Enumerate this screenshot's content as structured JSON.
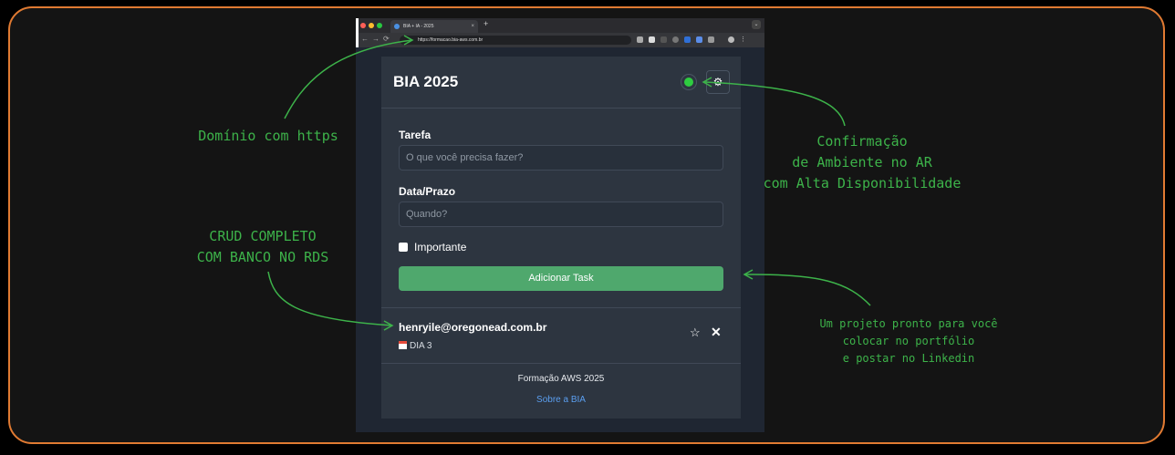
{
  "browser": {
    "tab_title": "BIA + IA - 2025",
    "tab_close": "×",
    "new_tab": "+",
    "tab_menu": "⌄",
    "url": "https://formacao.bia-aws.com.br",
    "nav_back": "←",
    "nav_forward": "→",
    "nav_reload": "⟳"
  },
  "app": {
    "title": "BIA 2025",
    "settings_icon": "⚙",
    "form": {
      "task_label": "Tarefa",
      "task_placeholder": "O que você precisa fazer?",
      "date_label": "Data/Prazo",
      "date_placeholder": "Quando?",
      "important_label": "Importante",
      "add_button": "Adicionar Task"
    },
    "tasks": [
      {
        "title": "henryile@oregonead.com.br",
        "date": "DIA 3",
        "star": "☆",
        "delete": "✕"
      }
    ],
    "footer": {
      "text": "Formação AWS 2025",
      "link": "Sobre a BIA"
    }
  },
  "annotations": {
    "domain": "Domínio com https",
    "crud_line1": "CRUD COMPLETO",
    "crud_line2": "COM BANCO NO RDS",
    "confirm_line1": "Confirmação",
    "confirm_line2": "de Ambiente no AR",
    "confirm_line3": "com Alta Disponibilidade",
    "portfolio_line1": "Um projeto pronto para você",
    "portfolio_line2": "colocar no portfólio",
    "portfolio_line3": "e postar no Linkedin"
  },
  "colors": {
    "accent_green": "#3db34a",
    "frame_orange": "#e07a32",
    "button_green": "#4fa86d",
    "link_blue": "#5b9ff0",
    "status_green": "#2ecc40"
  }
}
